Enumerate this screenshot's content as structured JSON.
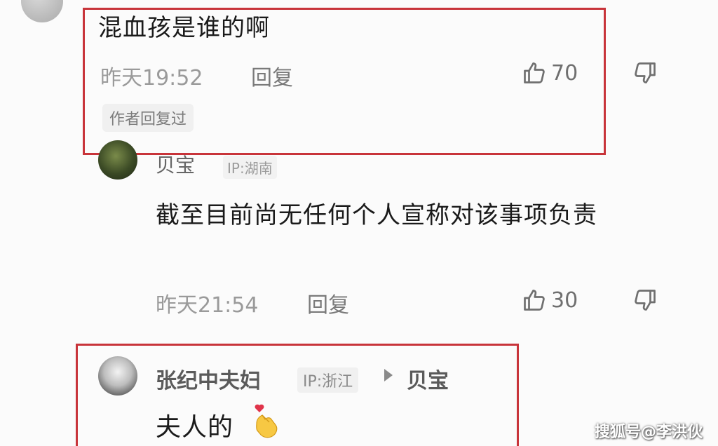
{
  "comments": [
    {
      "text": "混血孩是谁的啊",
      "time": "昨天19:52",
      "reply_label": "回复",
      "likes": "70",
      "badge": "作者回复过"
    },
    {
      "username": "贝宝",
      "ip": "IP:湖南",
      "text": "截至目前尚无任何个人宣称对该事项负责",
      "time": "昨天21:54",
      "reply_label": "回复",
      "likes": "30"
    },
    {
      "username": "张纪中夫妇",
      "ip": "IP:浙江",
      "reply_to": "贝宝",
      "text": "夫人的"
    }
  ],
  "watermark": "搜狐号@李洪伙",
  "highlight_color": "#c8343a"
}
